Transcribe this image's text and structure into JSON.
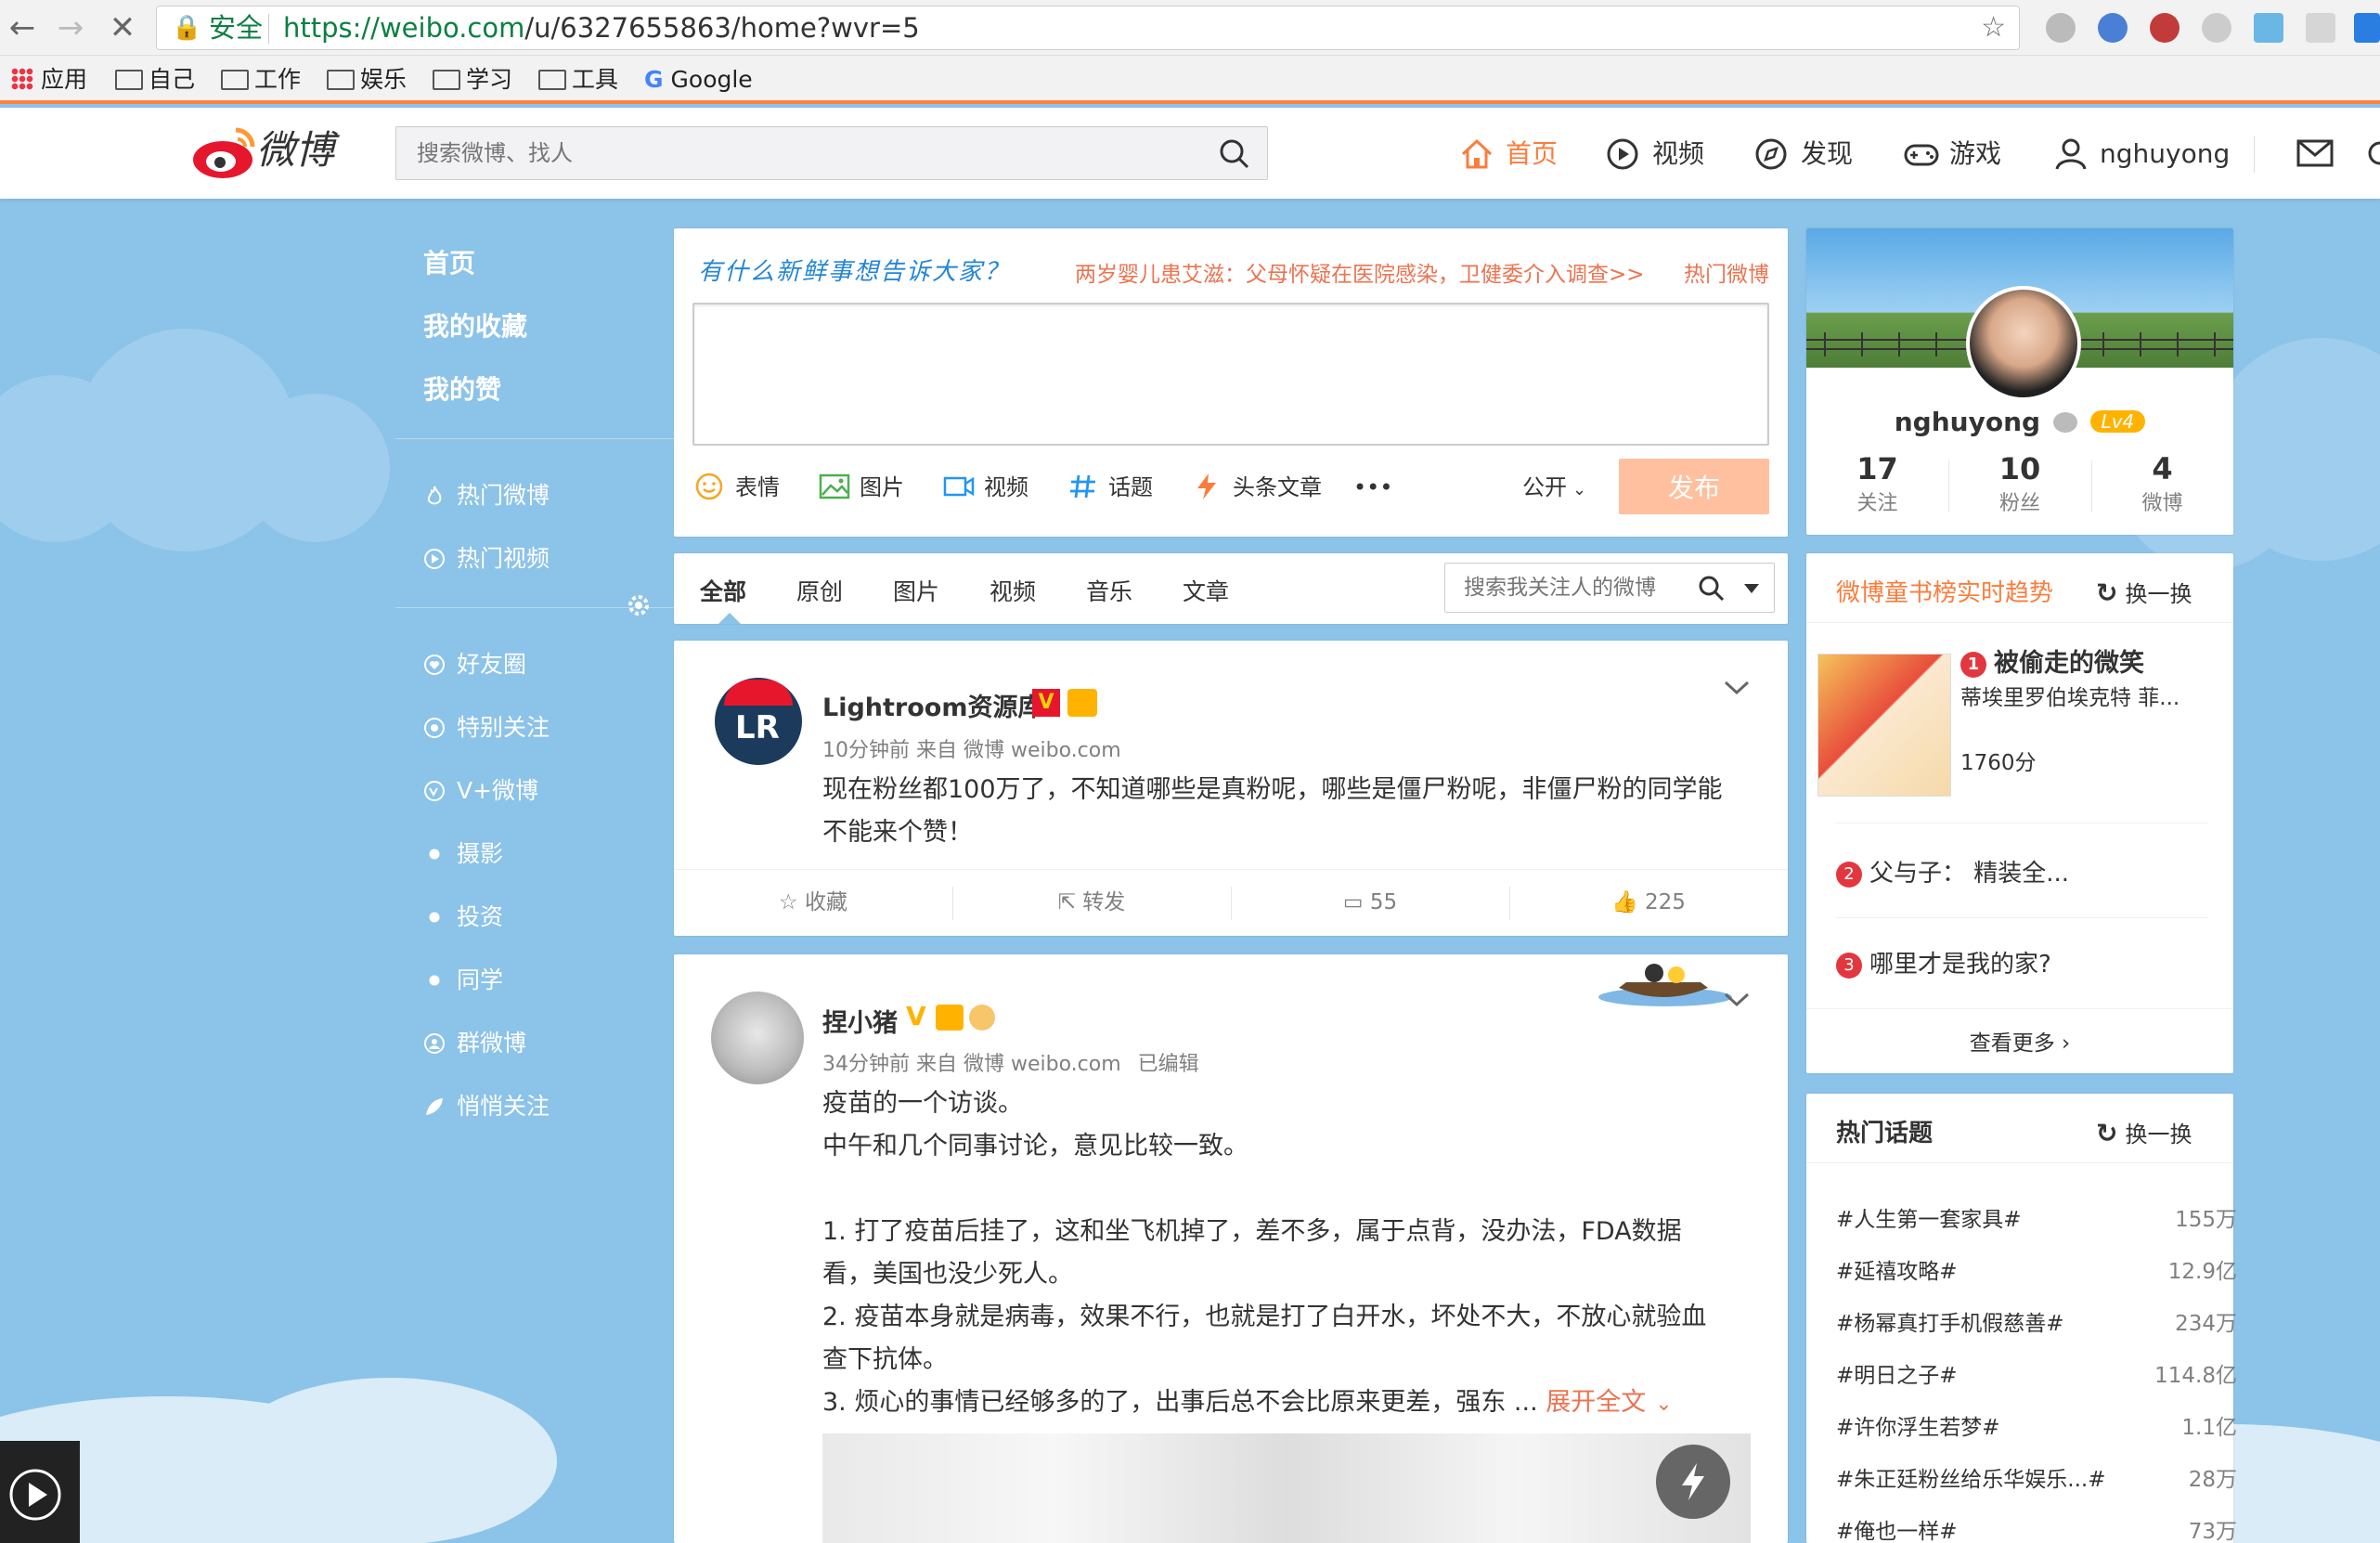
{
  "browser": {
    "secure_label": "安全",
    "url_host": "https://weibo.com",
    "url_path": "/u/6327655863/home?wvr=5",
    "bookmarks": [
      "应用",
      "自己",
      "工作",
      "娱乐",
      "学习",
      "工具",
      "Google"
    ]
  },
  "header": {
    "logo_text": "微博",
    "search_placeholder": "搜索微博、找人",
    "nav": [
      "首页",
      "视频",
      "发现",
      "游戏",
      "nghuyong"
    ]
  },
  "left_nav": {
    "top": [
      "首页",
      "我的收藏",
      "我的赞"
    ],
    "hot": [
      "热门微博",
      "热门视频"
    ],
    "groups": [
      "好友圈",
      "特别关注",
      "V+微博",
      "摄影",
      "投资",
      "同学",
      "群微博",
      "悄悄关注"
    ]
  },
  "composer": {
    "title": "有什么新鲜事想告诉大家？",
    "hot_headline": "两岁婴儿患艾滋：父母怀疑在医院感染，卫健委介入调查>>",
    "hot_label": "热门微博",
    "tools": [
      "表情",
      "图片",
      "视频",
      "话题",
      "头条文章",
      "•••"
    ],
    "visibility": "公开",
    "publish": "发布"
  },
  "tabs": {
    "items": [
      "全部",
      "原创",
      "图片",
      "视频",
      "音乐",
      "文章"
    ],
    "search_placeholder": "搜索我关注人的微博"
  },
  "posts": [
    {
      "name": "Lightroom资源库",
      "avatar_text": "LR",
      "meta": "10分钟前 来自 微博 weibo.com",
      "lines": [
        "现在粉丝都100万了，不知道哪些是真粉呢，哪些是僵尸粉呢，非僵尸粉的同学能",
        "不能来个赞！"
      ],
      "actions": {
        "fav": "收藏",
        "repost": "转发",
        "comment": "55",
        "like": "225"
      }
    },
    {
      "name": "捏小猪",
      "meta": "34分钟前 来自 微博 weibo.com",
      "edited": "已编辑",
      "lines": [
        "疫苗的一个访谈。",
        "中午和几个同事讨论，意见比较一致。",
        "1. 打了疫苗后挂了，这和坐飞机掉了，差不多，属于点背，没办法，FDA数据",
        "看，美国也没少死人。",
        "2. 疫苗本身就是病毒，效果不行，也就是打了白开水，坏处不大，不放心就验血",
        "查下抗体。",
        "3. 烦心的事情已经够多的了，出事后总不会比原来更差，强东 ..."
      ],
      "expand": "展开全文"
    }
  ],
  "profile": {
    "name": "nghuyong",
    "level": "Lv4",
    "stats": [
      {
        "value": "17",
        "label": "关注"
      },
      {
        "value": "10",
        "label": "粉丝"
      },
      {
        "value": "4",
        "label": "微博"
      }
    ]
  },
  "book_trend": {
    "title": "微博童书榜实时趋势",
    "refresh": "换一换",
    "items": [
      {
        "rank": "1",
        "title": "被偷走的微笑",
        "author": "蒂埃里罗伯埃克特 菲...",
        "score": "1760分"
      },
      {
        "rank": "2",
        "title": "父与子： 精装全..."
      },
      {
        "rank": "3",
        "title": "哪里才是我的家?"
      }
    ],
    "more": "查看更多 ›"
  },
  "hot_topics": {
    "title": "热门话题",
    "refresh": "换一换",
    "items": [
      {
        "name": "#人生第一套家具#",
        "count": "155万"
      },
      {
        "name": "#延禧攻略#",
        "count": "12.9亿"
      },
      {
        "name": "#杨幂真打手机假慈善#",
        "count": "234万"
      },
      {
        "name": "#明日之子#",
        "count": "114.8亿"
      },
      {
        "name": "#许你浮生若梦#",
        "count": "1.1亿"
      },
      {
        "name": "#朱正廷粉丝给乐华娱乐...#",
        "count": "28万"
      },
      {
        "name": "#俺也一样#",
        "count": "73万"
      }
    ]
  },
  "colors": {
    "accent": "#fa7d3c",
    "link_orange": "#eb7350",
    "sky": "#8cc3e8",
    "chrome_orange": "#ff8140"
  }
}
